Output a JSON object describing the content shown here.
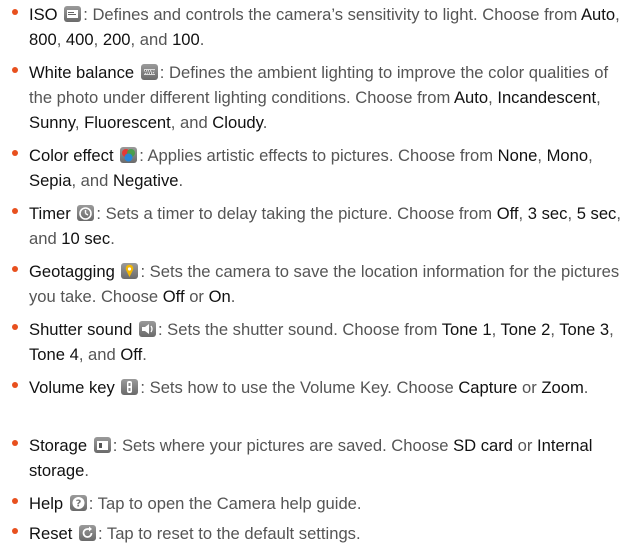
{
  "items": [
    {
      "name": "ISO",
      "icon": "iso-icon",
      "desc": ": Defines and controls the camera’s sensitivity to light. Choose from ",
      "opts": [
        "Auto",
        "800",
        "400",
        "200",
        "100"
      ],
      "tail": "."
    },
    {
      "name": "White balance",
      "icon": "white-balance-icon",
      "desc": ": Defines the ambient lighting to improve the color qualities of the photo under different lighting conditions. Choose from ",
      "opts": [
        "Auto",
        "Incandescent",
        "Sunny",
        "Fluorescent",
        "Cloudy"
      ],
      "tail": "."
    },
    {
      "name": "Color effect",
      "icon": "color-effect-icon",
      "desc": ": Applies artistic effects to pictures. Choose from ",
      "opts": [
        "None",
        "Mono",
        "Sepia",
        "Negative"
      ],
      "tail": "."
    },
    {
      "name": "Timer",
      "icon": "timer-icon",
      "desc": ": Sets a timer to delay taking the picture. Choose from ",
      "opts": [
        "Off",
        "3 sec",
        "5 sec",
        "10 sec"
      ],
      "tail": "."
    },
    {
      "name": "Geotagging",
      "icon": "geotagging-icon",
      "desc": ": Sets the camera to save the location information for the pictures you take. Choose ",
      "opts": [
        "Off",
        "On"
      ],
      "tail": ".",
      "or": true
    },
    {
      "name": "Shutter sound",
      "icon": "shutter-sound-icon",
      "desc": ": Sets the shutter sound. Choose from ",
      "opts": [
        "Tone 1",
        "Tone 2",
        "Tone 3",
        "Tone 4",
        "Off"
      ],
      "tail": "."
    },
    {
      "name": "Volume key",
      "icon": "volume-key-icon",
      "desc": ": Sets how to use the Volume Key. Choose ",
      "opts": [
        "Capture",
        "Zoom"
      ],
      "tail": ".",
      "or": true
    },
    {
      "name": "Storage",
      "icon": "storage-icon",
      "desc": ": Sets where your pictures are saved. Choose ",
      "opts": [
        "SD card",
        "Internal storage"
      ],
      "tail": ".",
      "or": true
    },
    {
      "name": "Help",
      "icon": "help-icon",
      "desc": ": Tap to open the Camera help guide.",
      "opts": [],
      "tail": ""
    },
    {
      "name": "Reset",
      "icon": "reset-icon",
      "desc": ": Tap to reset to the default settings.",
      "opts": [],
      "tail": ""
    }
  ],
  "colors": {
    "bullet": "#e8501e",
    "text": "#555555",
    "keyword": "#111111"
  }
}
